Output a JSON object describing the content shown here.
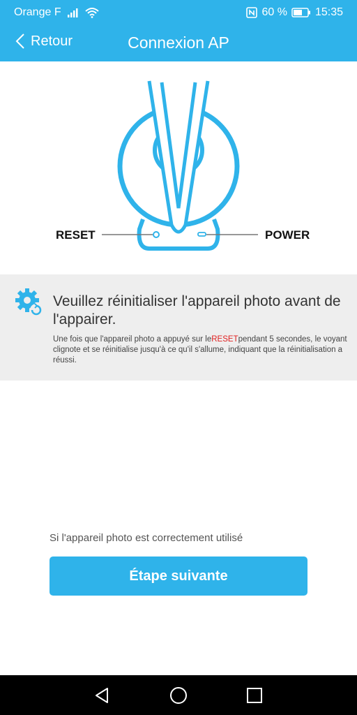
{
  "status_bar": {
    "carrier": "Orange F",
    "battery": "60 %",
    "time": "15:35",
    "icons": [
      "signal-icon",
      "wifi-icon",
      "nfc-icon",
      "battery-icon"
    ]
  },
  "nav": {
    "back_label": "Retour",
    "title": "Connexion AP"
  },
  "illustration": {
    "reset_label": "RESET",
    "power_label": "POWER"
  },
  "info": {
    "heading": "Veuillez réinitialiser l'appareil photo avant de l'appairer.",
    "desc_before": "Une fois que l'appareil photo a appuyé sur le",
    "desc_highlight": "RESET",
    "desc_after": "pendant 5 secondes, le voyant clignote et se réinitialise jusqu'à ce qu'il s'allume, indiquant que la réinitialisation a réussi."
  },
  "footer": {
    "hint": "Si l'appareil photo est correctement utilisé",
    "next_button": "Étape suivante"
  },
  "colors": {
    "accent": "#2fb3ea",
    "highlight": "#e02020",
    "panel": "#eeeeee"
  }
}
